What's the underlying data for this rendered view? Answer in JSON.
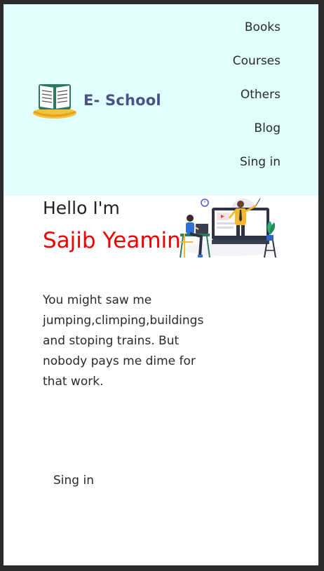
{
  "brand": {
    "name": "E- School",
    "logo_icon": "book-logo-icon"
  },
  "nav": {
    "items": [
      {
        "label": "Books"
      },
      {
        "label": "Courses"
      },
      {
        "label": "Others"
      },
      {
        "label": "Blog"
      },
      {
        "label": "Sing in"
      }
    ]
  },
  "hero": {
    "greeting": "Hello I'm",
    "name": "Sajib Yeamin",
    "bio": "You might saw me jumping,climping,buildings and stoping trains. But nobody pays me dime for that work.",
    "cta_label": "Sing in",
    "illustration": "online-class-illustration"
  },
  "colors": {
    "header_bg": "#e0fffe",
    "brand_text": "#4a5189",
    "name_accent": "#ee0000"
  }
}
